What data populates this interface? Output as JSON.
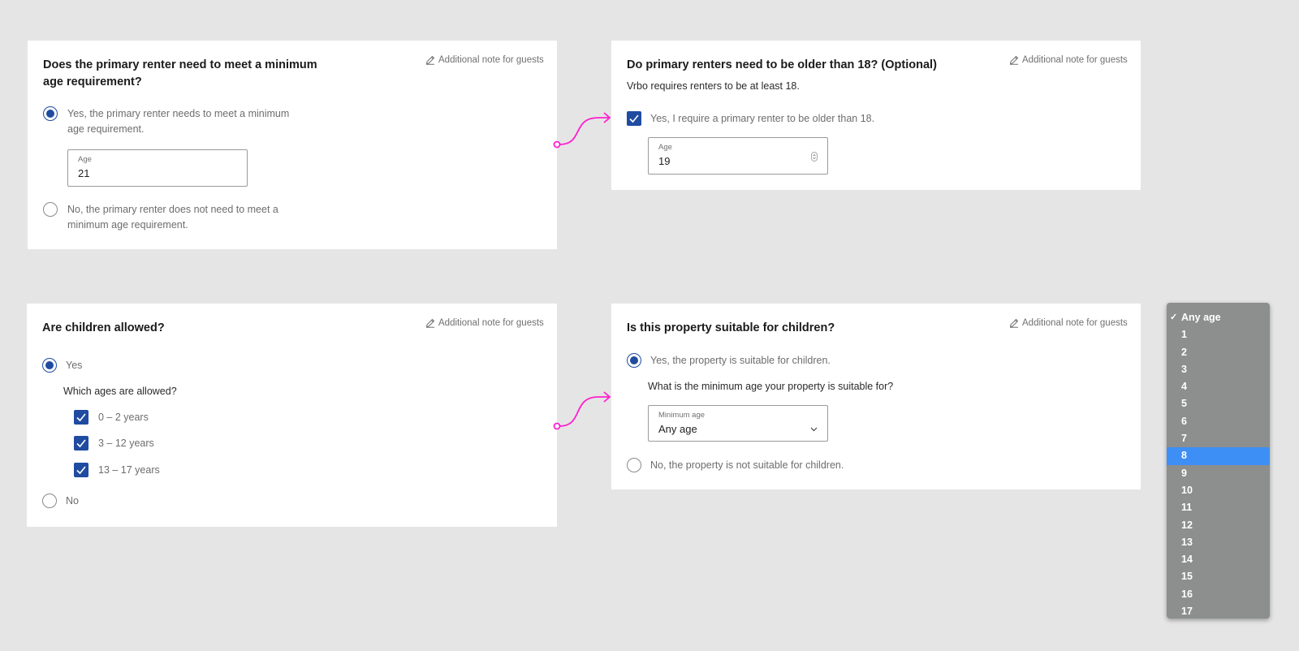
{
  "cards": {
    "min_age": {
      "title": "Does the primary renter need to meet a minimum age requirement?",
      "note": "Additional note for guests",
      "option_yes": "Yes, the primary renter needs to meet a minimum age requirement.",
      "age_label": "Age",
      "age_value": "21",
      "option_no": "No, the primary renter does not need to meet a minimum age requirement."
    },
    "older_than": {
      "title": "Do primary renters need to be older than 18? (Optional)",
      "note": "Additional note for guests",
      "subtitle": "Vrbo requires renters to be at least 18.",
      "checkbox_label": "Yes, I require a primary renter to be older than 18.",
      "age_label": "Age",
      "age_value": "19"
    },
    "children_allowed": {
      "title": "Are children allowed?",
      "note": "Additional note for guests",
      "option_yes": "Yes",
      "ages_question": "Which ages are allowed?",
      "age_ranges": [
        "0 – 2 years",
        "3 – 12 years",
        "13 – 17 years"
      ],
      "option_no": "No"
    },
    "suitable": {
      "title": "Is this property suitable for children?",
      "note": "Additional note for guests",
      "option_yes": "Yes, the property is suitable for children.",
      "min_age_question": "What is the minimum age your property is suitable for?",
      "select_label": "Minimum age",
      "select_value": "Any age",
      "option_no": "No, the property is not suitable for children."
    }
  },
  "dropdown": {
    "selected": "Any age",
    "highlighted": "8",
    "options": [
      "Any age",
      "1",
      "2",
      "3",
      "4",
      "5",
      "6",
      "7",
      "8",
      "9",
      "10",
      "11",
      "12",
      "13",
      "14",
      "15",
      "16",
      "17"
    ]
  },
  "colors": {
    "accent": "#1f4ba0",
    "connector": "#ff1fcf",
    "highlight": "#3d8ff5"
  }
}
